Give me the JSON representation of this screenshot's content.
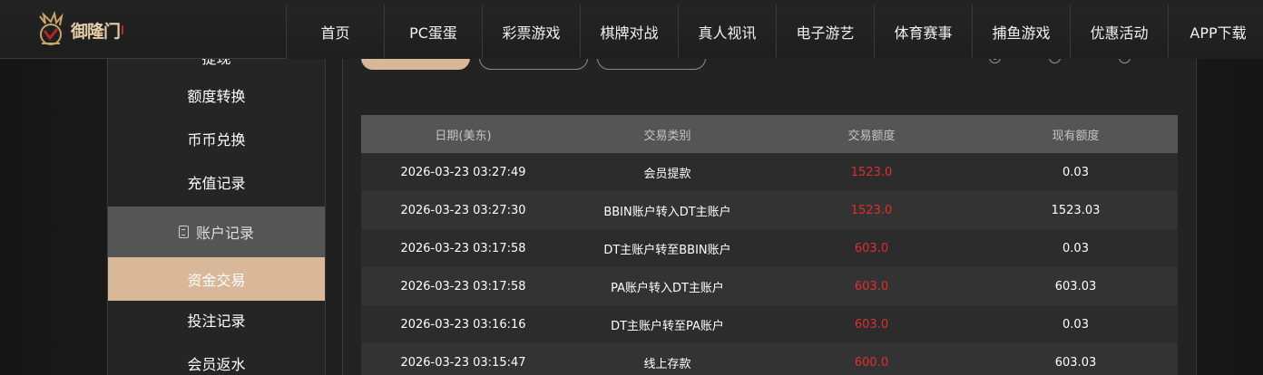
{
  "logo": {
    "text": "御隆门"
  },
  "nav": [
    {
      "label": "首页"
    },
    {
      "label": "PC蛋蛋"
    },
    {
      "label": "彩票游戏"
    },
    {
      "label": "棋牌对战"
    },
    {
      "label": "真人视讯"
    },
    {
      "label": "电子游艺"
    },
    {
      "label": "体育赛事"
    },
    {
      "label": "捕鱼游戏"
    },
    {
      "label": "优惠活动"
    },
    {
      "label": "APP下载"
    }
  ],
  "sidebar": {
    "partial_top": "提现",
    "items_above": [
      "额度转换",
      "币币兑换",
      "充值记录"
    ],
    "section_header": "账户记录",
    "active": "资金交易",
    "items_below": [
      "投注记录",
      "会员返水"
    ]
  },
  "table": {
    "columns": [
      "日期(美东)",
      "交易类别",
      "交易额度",
      "现有额度"
    ],
    "rows": [
      {
        "date": "2026-03-23 03:27:49",
        "type": "会员提款",
        "amount": "1523.0",
        "balance": "0.03"
      },
      {
        "date": "2026-03-23 03:27:30",
        "type": "BBIN账户转入DT主账户",
        "amount": "1523.0",
        "balance": "1523.03"
      },
      {
        "date": "2026-03-23 03:17:58",
        "type": "DT主账户转至BBIN账户",
        "amount": "603.0",
        "balance": "0.03"
      },
      {
        "date": "2026-03-23 03:17:58",
        "type": "PA账户转入DT主账户",
        "amount": "603.0",
        "balance": "603.03"
      },
      {
        "date": "2026-03-23 03:16:16",
        "type": "DT主账户转至PA账户",
        "amount": "603.0",
        "balance": "0.03"
      },
      {
        "date": "2026-03-23 03:15:47",
        "type": "线上存款",
        "amount": "600.0",
        "balance": "603.03"
      }
    ]
  },
  "colors": {
    "accent": "#d9b799",
    "amount_red": "#e02e2e",
    "header_gray": "#555555"
  }
}
